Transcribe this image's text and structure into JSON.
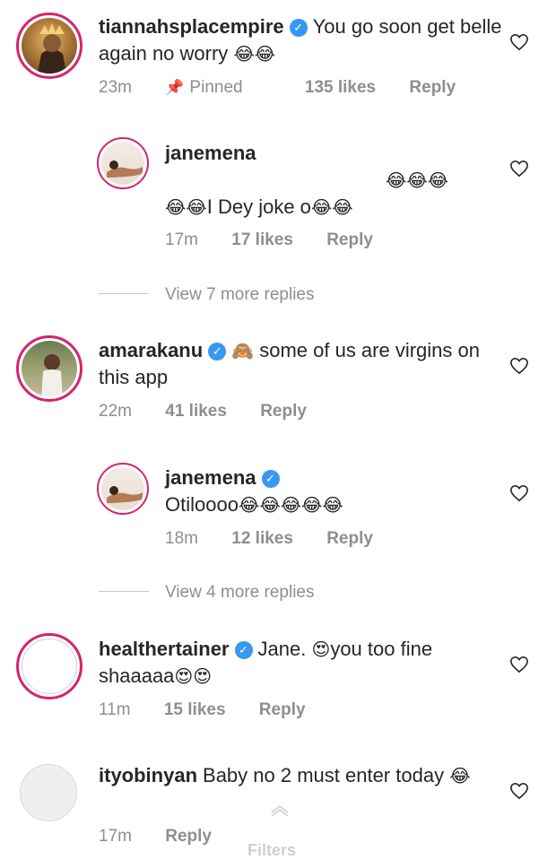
{
  "comments": [
    {
      "username": "tiannahsplacempire",
      "verified": true,
      "text": "You go soon get belle again no worry",
      "emoji": "😂😂",
      "time": "23m",
      "pinned": "Pinned",
      "likes": "135 likes",
      "reply": "Reply"
    },
    {
      "username": "janemena",
      "text": "I Dey joke o",
      "emoji_pre": "😂😂😂",
      "emoji_a": "😂😂",
      "emoji_b": "😂😂",
      "time": "17m",
      "likes": "17 likes",
      "reply": "Reply"
    },
    {
      "username": "amarakanu",
      "verified": true,
      "emoji_lead": "🙈",
      "text": "some of us are virgins on this app",
      "time": "22m",
      "likes": "41 likes",
      "reply": "Reply"
    },
    {
      "username": "janemena",
      "verified": true,
      "text": "Otiloooo",
      "emoji": "😂😂😂😂😂",
      "time": "18m",
      "likes": "12 likes",
      "reply": "Reply"
    },
    {
      "username": "healthertainer",
      "verified": true,
      "text_a": "Jane.",
      "emoji_a": "😍",
      "text_b": "you too fine shaaaaa",
      "emoji_b": "😍😍",
      "time": "11m",
      "likes": "15 likes",
      "reply": "Reply"
    },
    {
      "username": "ityobinyan",
      "text": "Baby no 2 must enter today",
      "emoji": "😂",
      "time": "17m",
      "reply": "Reply"
    }
  ],
  "view_more_1": "View 7 more replies",
  "view_more_2": "View 4 more replies",
  "filters_label": "Filters",
  "icons": {
    "heart": "heart-outline-icon",
    "pin": "pin-icon",
    "verified": "verified-badge-icon"
  },
  "colors": {
    "ring": "#d6246e",
    "verified": "#3897f0",
    "muted": "#8e8e8e"
  }
}
